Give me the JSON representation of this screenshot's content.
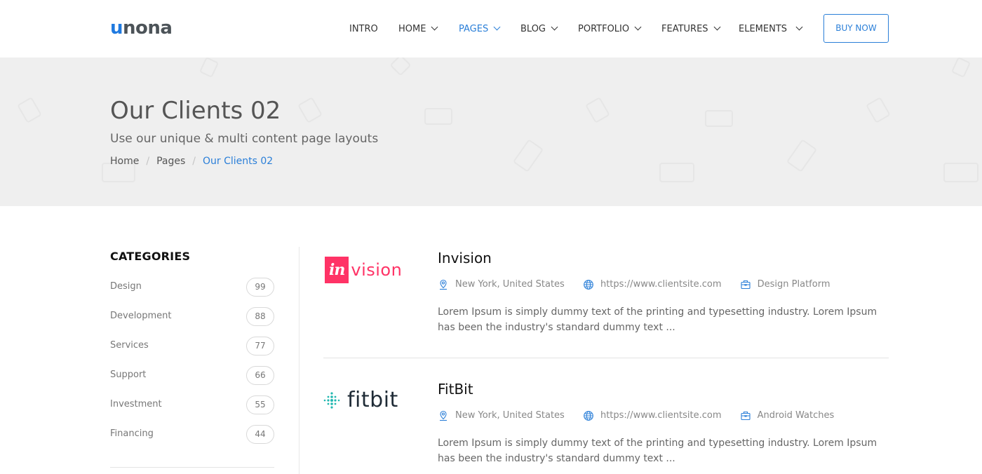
{
  "header": {
    "logo_text": "unona",
    "nav": [
      {
        "label": "INTRO",
        "has_dropdown": false,
        "active": false
      },
      {
        "label": "HOME",
        "has_dropdown": true,
        "active": false
      },
      {
        "label": "PAGES",
        "has_dropdown": true,
        "active": true
      },
      {
        "label": "BLOG",
        "has_dropdown": true,
        "active": false
      },
      {
        "label": "PORTFOLIO",
        "has_dropdown": true,
        "active": false
      },
      {
        "label": "FEATURES",
        "has_dropdown": true,
        "active": false
      },
      {
        "label": "ELEMENTS",
        "has_dropdown": true,
        "active": false
      }
    ],
    "buy_label": "BUY NOW"
  },
  "hero": {
    "title": "Our Clients 02",
    "subtitle": "Use our unique & multi content page layouts",
    "breadcrumb": [
      "Home",
      "Pages",
      "Our Clients 02"
    ]
  },
  "sidebar": {
    "title": "CATEGORIES",
    "categories": [
      {
        "label": "Design",
        "count": "99"
      },
      {
        "label": "Development",
        "count": "88"
      },
      {
        "label": "Services",
        "count": "77"
      },
      {
        "label": "Support",
        "count": "66"
      },
      {
        "label": "Investment",
        "count": "55"
      },
      {
        "label": "Financing",
        "count": "44"
      }
    ]
  },
  "clients": [
    {
      "name": "Invision",
      "logo": {
        "box": "in",
        "rest": "vision"
      },
      "location": "New York, United States",
      "website": "https://www.clientsite.com",
      "category": "Design Platform",
      "description": "Lorem Ipsum is simply dummy text of the printing and typesetting industry. Lorem Ipsum has been the industry's standard dummy text ..."
    },
    {
      "name": "FitBit",
      "logo": {
        "text": "fitbit"
      },
      "location": "New York, United States",
      "website": "https://www.clientsite.com",
      "category": "Android Watches",
      "description": "Lorem Ipsum is simply dummy text of the printing and typesetting industry. Lorem Ipsum has been the industry's standard dummy text ..."
    }
  ],
  "colors": {
    "accent": "#2b7fd8",
    "hero_bg": "#efefef",
    "invision_brand": "#ff3366",
    "fitbit_dots": "#22b8b0"
  }
}
